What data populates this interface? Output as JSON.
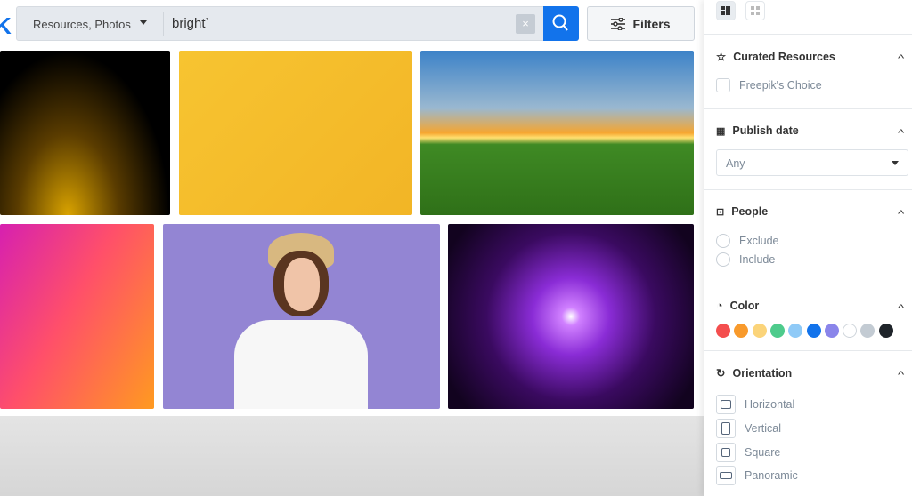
{
  "search": {
    "resource_type": "Resources, Photos",
    "query": "bright`",
    "clear_label": "×",
    "filters_label": "Filters"
  },
  "images": [
    {
      "name": "golden-particles",
      "colors": [
        "#000",
        "#3a2800",
        "#d9a300"
      ]
    },
    {
      "name": "yellow-texture",
      "colors": [
        "#f7c431",
        "#f3b728"
      ]
    },
    {
      "name": "sunset-field",
      "colors": [
        "#3c82c8",
        "#f6a630",
        "#3f8a24"
      ]
    },
    {
      "name": "pink-orange-gradient",
      "colors": [
        "#d620b0",
        "#ff5a5a",
        "#ffa020"
      ]
    },
    {
      "name": "surprised-woman",
      "colors": [
        "#8e7fd0",
        "#9b8ad6"
      ]
    },
    {
      "name": "purple-lightspeed",
      "colors": [
        "#1a0530",
        "#8a2cd6",
        "#1a0530"
      ]
    }
  ],
  "sidebar": {
    "curated": {
      "title": "Curated Resources",
      "option": "Freepik's Choice"
    },
    "publish": {
      "title": "Publish date",
      "value": "Any"
    },
    "people": {
      "title": "People",
      "options": [
        "Exclude",
        "Include"
      ]
    },
    "color": {
      "title": "Color",
      "swatches": [
        "#f44e4e",
        "#f89a2c",
        "#fbd47a",
        "#4ecb8c",
        "#8fcaf7",
        "#1273eb",
        "#8a85ea",
        "#ffffff",
        "#c3cbd3",
        "#1f242a"
      ]
    },
    "orientation": {
      "title": "Orientation",
      "options": [
        "Horizontal",
        "Vertical",
        "Square",
        "Panoramic"
      ]
    }
  }
}
